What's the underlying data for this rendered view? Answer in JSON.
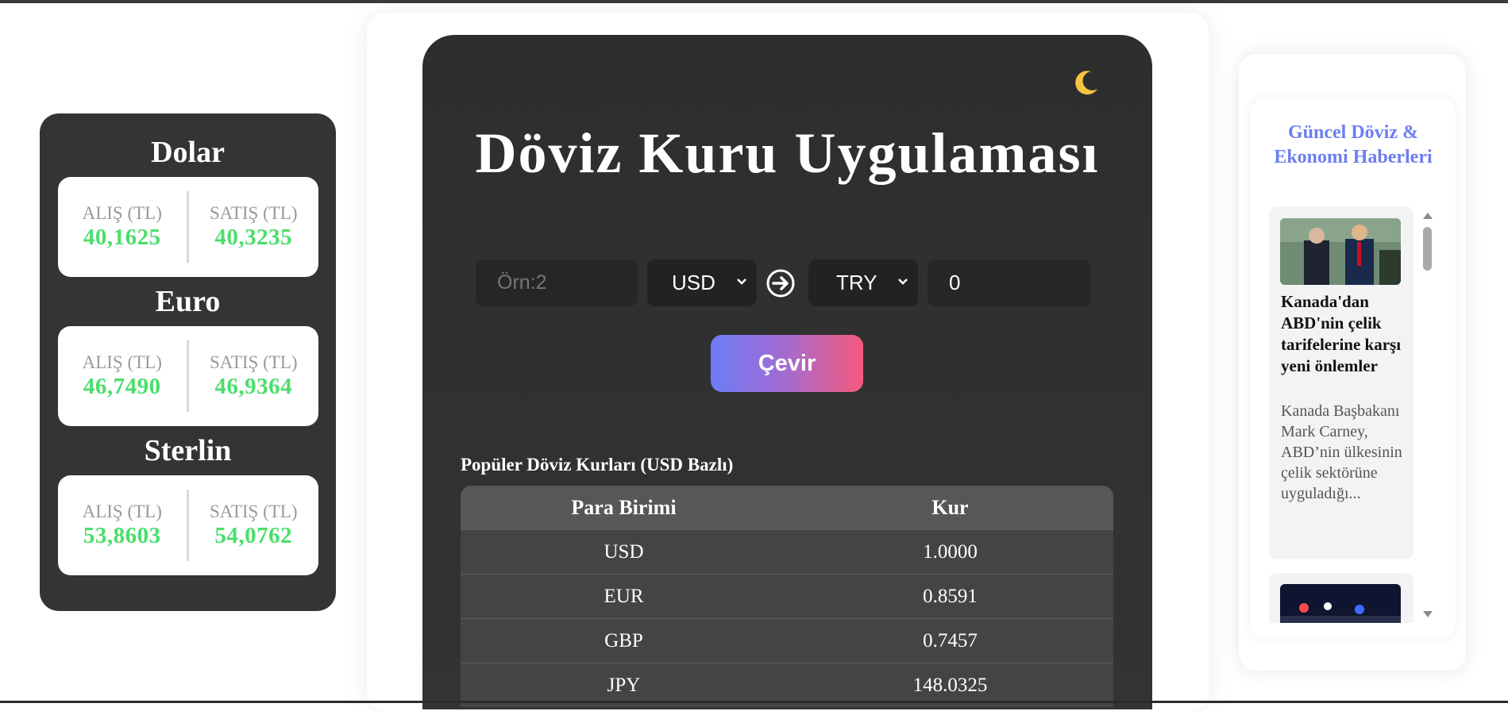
{
  "rates": [
    {
      "name": "Dolar",
      "buy_label": "ALIŞ (TL)",
      "buy": "40,1625",
      "sell_label": "SATIŞ (TL)",
      "sell": "40,3235"
    },
    {
      "name": "Euro",
      "buy_label": "ALIŞ (TL)",
      "buy": "46,7490",
      "sell_label": "SATIŞ (TL)",
      "sell": "46,9364"
    },
    {
      "name": "Sterlin",
      "buy_label": "ALIŞ (TL)",
      "buy": "53,8603",
      "sell_label": "SATIŞ (TL)",
      "sell": "54,0762"
    }
  ],
  "converter": {
    "title": "Döviz Kuru Uygulaması",
    "theme_icon": "moon-icon",
    "amount_placeholder": "Örn:2",
    "from_currency": "USD",
    "to_currency": "TRY",
    "result": "0",
    "convert_label": "Çevir"
  },
  "popular": {
    "title": "Popüler Döviz Kurları (USD Bazlı)",
    "headers": [
      "Para Birimi",
      "Kur"
    ],
    "rows": [
      [
        "USD",
        "1.0000"
      ],
      [
        "EUR",
        "0.8591"
      ],
      [
        "GBP",
        "0.7457"
      ],
      [
        "JPY",
        "148.0325"
      ]
    ]
  },
  "news": {
    "title": "Güncel Döviz & Ekonomi Haberleri",
    "items": [
      {
        "headline": "Kanada'dan ABD'nin çelik tarifelerine karşı yeni önlemler",
        "summary": "Kanada Başbakanı Mark Carney, ABD’nin ülkesinin çelik sektörüne uyguladığı..."
      }
    ]
  },
  "colors": {
    "accent": "#6b7ff0",
    "positive": "#4ade6b",
    "button_start": "#6d7cf7",
    "button_end": "#f6587c"
  }
}
